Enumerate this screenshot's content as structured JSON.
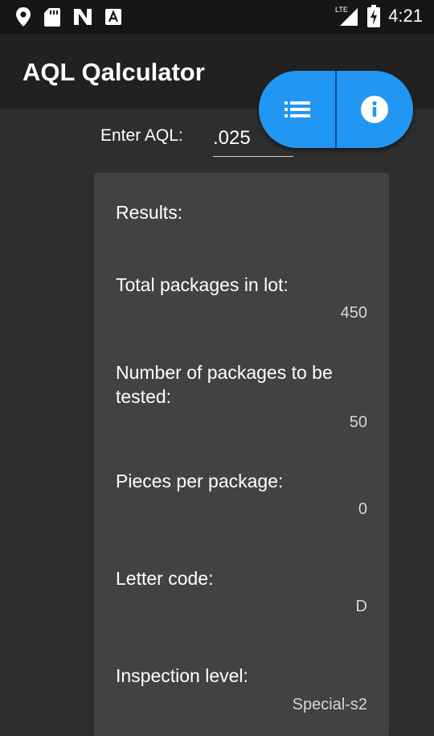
{
  "status_bar": {
    "time": "4:21",
    "network": "LTE",
    "icons": [
      "location-icon",
      "sd-card-icon",
      "n-icon",
      "a-icon",
      "signal-icon",
      "battery-charging-icon"
    ]
  },
  "app": {
    "title": "AQL Qalculator",
    "accent_color": "#2196f3"
  },
  "fab": {
    "left_icon": "list-icon",
    "right_icon": "info-icon"
  },
  "aql": {
    "label": "Enter AQL:",
    "value": ".025"
  },
  "results": {
    "heading": "Results:",
    "items": [
      {
        "label": "Total packages in lot:",
        "value": "450"
      },
      {
        "label": "Number of packages to be tested:",
        "value": "50"
      },
      {
        "label": "Pieces per package:",
        "value": "0"
      },
      {
        "label": "Letter code:",
        "value": "D"
      },
      {
        "label": "Inspection level:",
        "value": "Special-s2"
      }
    ]
  }
}
